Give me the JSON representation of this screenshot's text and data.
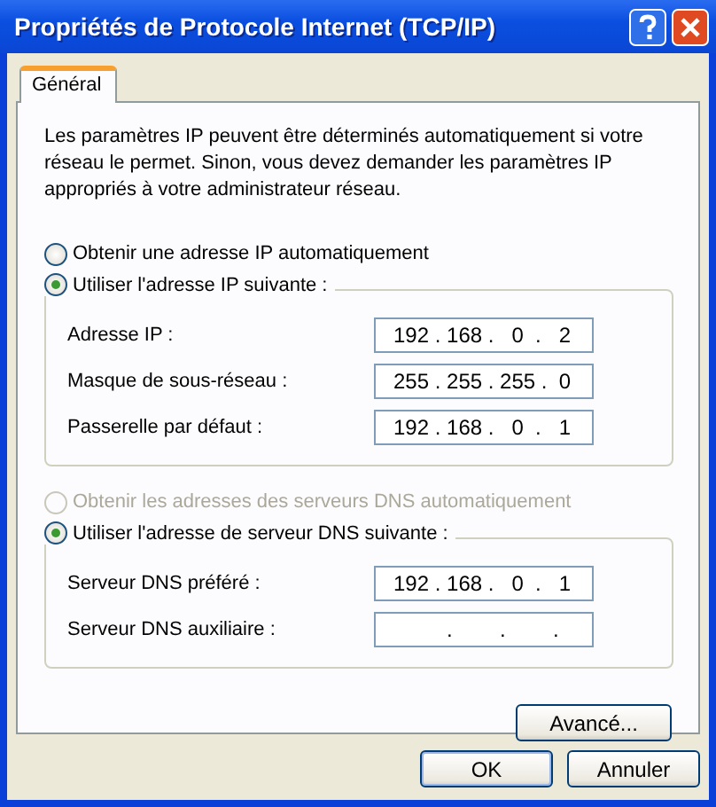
{
  "window": {
    "title": "Propriétés de Protocole Internet (TCP/IP)"
  },
  "tabs": [
    {
      "label": "Général",
      "selected": true
    }
  ],
  "intro": "Les paramètres IP peuvent être déterminés automatiquement si votre réseau le permet. Sinon, vous devez demander les paramètres IP appropriés à votre administrateur réseau.",
  "sections": [
    {
      "options": [
        {
          "label": "Obtenir une adresse IP automatiquement",
          "selected": false,
          "disabled": false
        },
        {
          "label": "Utiliser l'adresse IP suivante :",
          "selected": true,
          "disabled": false,
          "fields": [
            {
              "label": "Adresse IP :",
              "value": "192 . 168 .   0  .   2"
            },
            {
              "label": "Masque de sous-réseau :",
              "value": "255 . 255 . 255 .  0"
            },
            {
              "label": "Passerelle par défaut :",
              "value": "192 . 168 .   0  .   1"
            }
          ]
        }
      ]
    },
    {
      "options": [
        {
          "label": "Obtenir les adresses des serveurs DNS automatiquement",
          "selected": false,
          "disabled": true
        },
        {
          "label": "Utiliser l'adresse de serveur DNS suivante :",
          "selected": true,
          "disabled": false,
          "fields": [
            {
              "label": "Serveur DNS préféré :",
              "value": "192 . 168 .   0  .   1"
            },
            {
              "label": "Serveur DNS auxiliaire :",
              "value": "         .        .        ."
            }
          ]
        }
      ]
    }
  ],
  "advanced_button": "Avancé...",
  "buttons": [
    {
      "label": "OK",
      "default": true
    },
    {
      "label": "Annuler",
      "default": false
    }
  ]
}
